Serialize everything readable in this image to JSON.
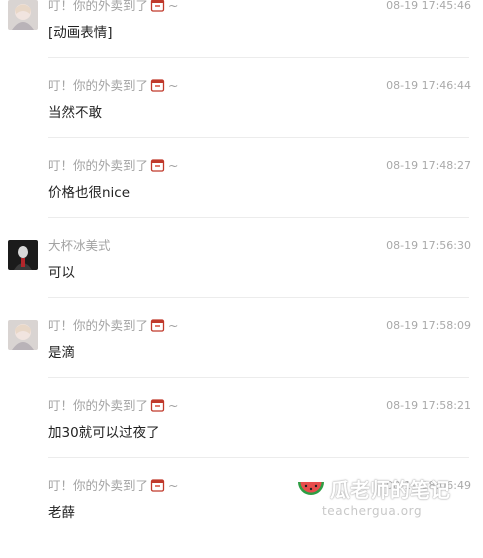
{
  "messages": [
    {
      "name": "叮！你的外卖到了",
      "suffix": "~",
      "time": "08-19 17:45:46",
      "text": "[动画表情]",
      "avatar": "photo"
    },
    {
      "name": "叮！你的外卖到了",
      "suffix": "~",
      "time": "08-19 17:46:44",
      "text": "当然不敢",
      "avatar": "none"
    },
    {
      "name": "叮！你的外卖到了",
      "suffix": "~",
      "time": "08-19 17:48:27",
      "text": "价格也很nice",
      "avatar": "none"
    },
    {
      "name": "大杯冰美式",
      "suffix": "",
      "time": "08-19 17:56:30",
      "text": "可以",
      "avatar": "dark"
    },
    {
      "name": "叮！你的外卖到了",
      "suffix": "~",
      "time": "08-19 17:58:09",
      "text": "是滴",
      "avatar": "photo"
    },
    {
      "name": "叮！你的外卖到了",
      "suffix": "~",
      "time": "08-19 17:58:21",
      "text": "加30就可以过夜了",
      "avatar": "none"
    },
    {
      "name": "叮！你的外卖到了",
      "suffix": "~",
      "time": "08-19 18:06:49",
      "text": "老薛",
      "avatar": "none"
    }
  ],
  "watermark": {
    "title": "瓜老师的笔记",
    "url": "teachergua.org"
  },
  "colors": {
    "name": "#a3a3a3",
    "time": "#a9a9a9",
    "text": "#222222",
    "separator": "#ececec",
    "bag_icon": "#c0392b"
  }
}
